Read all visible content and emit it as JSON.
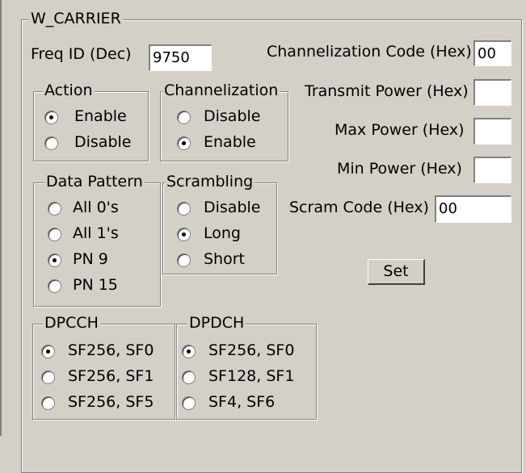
{
  "group_title": "W_CARRIER",
  "freq_id": {
    "label": "Freq ID (Dec)",
    "value": "9750"
  },
  "channelization_code": {
    "label": "Channelization Code (Hex)",
    "value": "00"
  },
  "transmit_power": {
    "label": "Transmit Power (Hex)",
    "value": ""
  },
  "max_power": {
    "label": "Max Power (Hex)",
    "value": ""
  },
  "min_power": {
    "label": "Min Power (Hex)",
    "value": ""
  },
  "scram_code": {
    "label": "Scram Code (Hex)",
    "value": "00"
  },
  "set_button": "Set",
  "action": {
    "title": "Action",
    "options": [
      "Enable",
      "Disable"
    ],
    "selected": "Enable"
  },
  "channelization": {
    "title": "Channelization",
    "options": [
      "Disable",
      "Enable"
    ],
    "selected": "Enable"
  },
  "data_pattern": {
    "title": "Data Pattern",
    "options": [
      "All 0's",
      "All 1's",
      "PN 9",
      "PN 15"
    ],
    "selected": "PN 9"
  },
  "scrambling": {
    "title": "Scrambling",
    "options": [
      "Disable",
      "Long",
      "Short"
    ],
    "selected": "Long"
  },
  "dpcch": {
    "title": "DPCCH",
    "options": [
      "SF256, SF0",
      "SF256, SF1",
      "SF256, SF5"
    ],
    "selected": "SF256, SF0"
  },
  "dpdch": {
    "title": "DPDCH",
    "options": [
      "SF256, SF0",
      "SF128, SF1",
      "SF4, SF6"
    ],
    "selected": "SF256, SF0"
  }
}
